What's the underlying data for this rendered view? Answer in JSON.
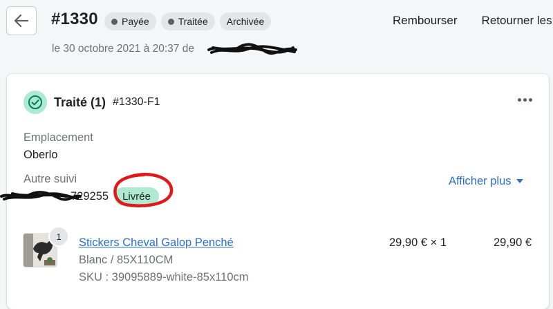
{
  "header": {
    "order_number": "#1330",
    "badges": [
      {
        "label": "Payée",
        "dot": true
      },
      {
        "label": "Traitée",
        "dot": true
      },
      {
        "label": "Archivée",
        "dot": false
      }
    ],
    "actions": [
      "Rembourser",
      "Retourner les"
    ],
    "subtitle": "le 30 octobre 2021 à 20:37 de"
  },
  "fulfillment": {
    "status": "Traité (1)",
    "id": "#1330-F1",
    "location_label": "Emplacement",
    "location_value": "Oberlo",
    "tracking_label": "Autre suivi",
    "tracking_number_visible": "729255",
    "delivery_badge": "Livrée",
    "show_more": "Afficher plus",
    "product": {
      "quantity_badge": "1",
      "name": "Stickers Cheval Galop Penché",
      "variant": "Blanc / 85X110CM",
      "sku": "SKU : 39095889-white-85x110cm",
      "unit_price": "29,90 € × 1",
      "total": "29,90 €"
    }
  },
  "colors": {
    "background": "#f4f6f8",
    "badge_bg": "#e4e5e7",
    "success_bg": "#aee9d1",
    "link": "#2c6ecb",
    "annotation_red": "#e0191b"
  }
}
